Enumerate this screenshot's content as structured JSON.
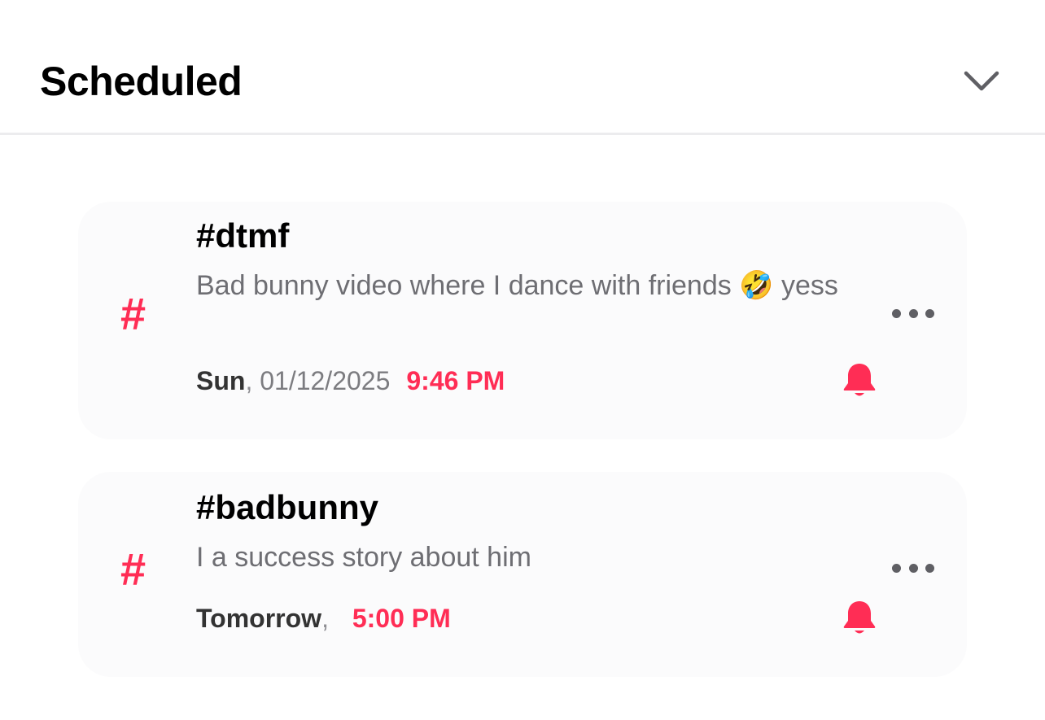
{
  "header": {
    "title": "Scheduled",
    "toggle_icon": "chevron-down-icon"
  },
  "colors": {
    "accent": "#ff2d55",
    "card_background": "#fbfbfc",
    "secondary_text": "#6e6e73"
  },
  "scheduled_posts": [
    {
      "channel": "#dtmf",
      "message": "Bad bunny video where I dance with friends 🤣 yess",
      "day": "Sun",
      "separator": ", ",
      "date": "01/12/2025",
      "time": "9:46 PM",
      "icon": "hashtag-icon",
      "reminder_icon": "bell-icon",
      "menu_icon": "more-icon"
    },
    {
      "channel": "#badbunny",
      "message": "I a success story about him",
      "day": "Tomorrow",
      "separator": ", ",
      "date": "",
      "time": "5:00 PM",
      "icon": "hashtag-icon",
      "reminder_icon": "bell-icon",
      "menu_icon": "more-icon"
    }
  ]
}
